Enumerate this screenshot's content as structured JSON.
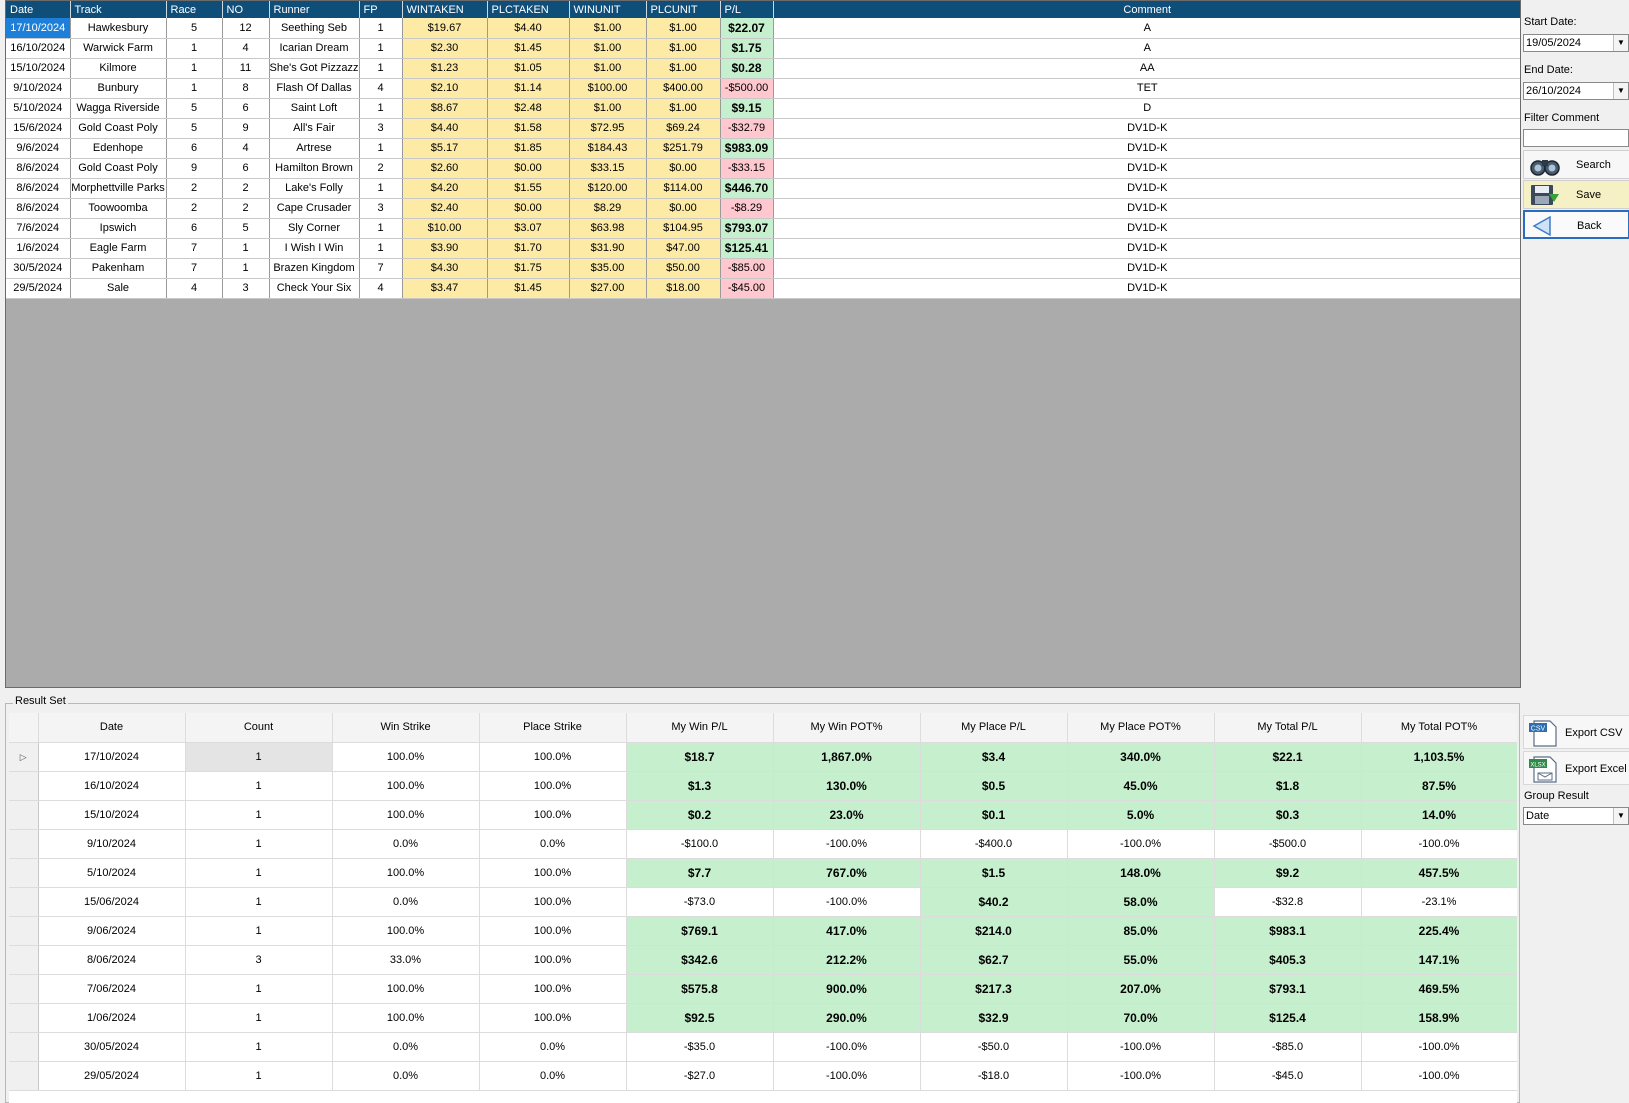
{
  "top_grid": {
    "columns": [
      "Date",
      "Track",
      "Race",
      "NO",
      "Runner",
      "FP",
      "WINTAKEN",
      "PLCTAKEN",
      "WINUNIT",
      "PLCUNIT",
      "P/L",
      "Comment"
    ],
    "rows": [
      {
        "date": "17/10/2024",
        "track": "Hawkesbury",
        "race": "5",
        "no": "12",
        "runner": "Seething Seb",
        "fp": "1",
        "wintaken": "$19.67",
        "plctaken": "$4.40",
        "winunit": "$1.00",
        "plcunit": "$1.00",
        "pl": "$22.07",
        "pl_sign": "pos",
        "comment": "A"
      },
      {
        "date": "16/10/2024",
        "track": "Warwick Farm",
        "race": "1",
        "no": "4",
        "runner": "Icarian Dream",
        "fp": "1",
        "wintaken": "$2.30",
        "plctaken": "$1.45",
        "winunit": "$1.00",
        "plcunit": "$1.00",
        "pl": "$1.75",
        "pl_sign": "pos",
        "comment": "A"
      },
      {
        "date": "15/10/2024",
        "track": "Kilmore",
        "race": "1",
        "no": "11",
        "runner": "She's Got Pizzazz",
        "fp": "1",
        "wintaken": "$1.23",
        "plctaken": "$1.05",
        "winunit": "$1.00",
        "plcunit": "$1.00",
        "pl": "$0.28",
        "pl_sign": "pos",
        "comment": "AA"
      },
      {
        "date": "9/10/2024",
        "track": "Bunbury",
        "race": "1",
        "no": "8",
        "runner": "Flash Of Dallas",
        "fp": "4",
        "wintaken": "$2.10",
        "plctaken": "$1.14",
        "winunit": "$100.00",
        "plcunit": "$400.00",
        "pl": "-$500.00",
        "pl_sign": "neg",
        "comment": "TET"
      },
      {
        "date": "5/10/2024",
        "track": "Wagga Riverside",
        "race": "5",
        "no": "6",
        "runner": "Saint Loft",
        "fp": "1",
        "wintaken": "$8.67",
        "plctaken": "$2.48",
        "winunit": "$1.00",
        "plcunit": "$1.00",
        "pl": "$9.15",
        "pl_sign": "pos",
        "comment": "D"
      },
      {
        "date": "15/6/2024",
        "track": "Gold Coast Poly",
        "race": "5",
        "no": "9",
        "runner": "All's Fair",
        "fp": "3",
        "wintaken": "$4.40",
        "plctaken": "$1.58",
        "winunit": "$72.95",
        "plcunit": "$69.24",
        "pl": "-$32.79",
        "pl_sign": "neg",
        "comment": "DV1D-K"
      },
      {
        "date": "9/6/2024",
        "track": "Edenhope",
        "race": "6",
        "no": "4",
        "runner": "Artrese",
        "fp": "1",
        "wintaken": "$5.17",
        "plctaken": "$1.85",
        "winunit": "$184.43",
        "plcunit": "$251.79",
        "pl": "$983.09",
        "pl_sign": "pos",
        "comment": "DV1D-K"
      },
      {
        "date": "8/6/2024",
        "track": "Gold Coast Poly",
        "race": "9",
        "no": "6",
        "runner": "Hamilton Brown",
        "fp": "2",
        "wintaken": "$2.60",
        "plctaken": "$0.00",
        "winunit": "$33.15",
        "plcunit": "$0.00",
        "pl": "-$33.15",
        "pl_sign": "neg",
        "comment": "DV1D-K"
      },
      {
        "date": "8/6/2024",
        "track": "Morphettville Parks",
        "race": "2",
        "no": "2",
        "runner": "Lake's Folly",
        "fp": "1",
        "wintaken": "$4.20",
        "plctaken": "$1.55",
        "winunit": "$120.00",
        "plcunit": "$114.00",
        "pl": "$446.70",
        "pl_sign": "pos",
        "comment": "DV1D-K"
      },
      {
        "date": "8/6/2024",
        "track": "Toowoomba",
        "race": "2",
        "no": "2",
        "runner": "Cape Crusader",
        "fp": "3",
        "wintaken": "$2.40",
        "plctaken": "$0.00",
        "winunit": "$8.29",
        "plcunit": "$0.00",
        "pl": "-$8.29",
        "pl_sign": "neg",
        "comment": "DV1D-K"
      },
      {
        "date": "7/6/2024",
        "track": "Ipswich",
        "race": "6",
        "no": "5",
        "runner": "Sly Corner",
        "fp": "1",
        "wintaken": "$10.00",
        "plctaken": "$3.07",
        "winunit": "$63.98",
        "plcunit": "$104.95",
        "pl": "$793.07",
        "pl_sign": "pos",
        "comment": "DV1D-K"
      },
      {
        "date": "1/6/2024",
        "track": "Eagle Farm",
        "race": "7",
        "no": "1",
        "runner": "I Wish I Win",
        "fp": "1",
        "wintaken": "$3.90",
        "plctaken": "$1.70",
        "winunit": "$31.90",
        "plcunit": "$47.00",
        "pl": "$125.41",
        "pl_sign": "pos",
        "comment": "DV1D-K"
      },
      {
        "date": "30/5/2024",
        "track": "Pakenham",
        "race": "7",
        "no": "1",
        "runner": "Brazen Kingdom",
        "fp": "7",
        "wintaken": "$4.30",
        "plctaken": "$1.75",
        "winunit": "$35.00",
        "plcunit": "$50.00",
        "pl": "-$85.00",
        "pl_sign": "neg",
        "comment": "DV1D-K"
      },
      {
        "date": "29/5/2024",
        "track": "Sale",
        "race": "4",
        "no": "3",
        "runner": "Check Your Six",
        "fp": "4",
        "wintaken": "$3.47",
        "plctaken": "$1.45",
        "winunit": "$27.00",
        "plcunit": "$18.00",
        "pl": "-$45.00",
        "pl_sign": "neg",
        "comment": "DV1D-K"
      }
    ]
  },
  "side_panel": {
    "start_date_label": "Start Date:",
    "start_date_value": "19/05/2024",
    "end_date_label": "End Date:",
    "end_date_value": "26/10/2024",
    "filter_comment_label": "Filter Comment",
    "filter_comment_value": "",
    "search_label": "Search",
    "save_label": "Save",
    "back_label": "Back",
    "search_icon": "binoculars-icon",
    "save_icon": "floppy-disk-icon",
    "back_icon": "left-arrow-icon"
  },
  "result_set": {
    "legend": "Result Set",
    "columns": [
      "Date",
      "Count",
      "Win Strike",
      "Place Strike",
      "My Win P/L",
      "My Win POT%",
      "My Place P/L",
      "My Place POT%",
      "My Total P/L",
      "My Total POT%"
    ],
    "rows": [
      {
        "date": "17/10/2024",
        "count": "1",
        "win_strike": "100.0%",
        "place_strike": "100.0%",
        "win_pl": "$18.7",
        "win_pot": "1,867.0%",
        "place_pl": "$3.4",
        "place_pot": "340.0%",
        "total_pl": "$22.1",
        "total_pot": "1,103.5%",
        "win_pos": true,
        "place_pos": true,
        "total_pos": true
      },
      {
        "date": "16/10/2024",
        "count": "1",
        "win_strike": "100.0%",
        "place_strike": "100.0%",
        "win_pl": "$1.3",
        "win_pot": "130.0%",
        "place_pl": "$0.5",
        "place_pot": "45.0%",
        "total_pl": "$1.8",
        "total_pot": "87.5%",
        "win_pos": true,
        "place_pos": true,
        "total_pos": true
      },
      {
        "date": "15/10/2024",
        "count": "1",
        "win_strike": "100.0%",
        "place_strike": "100.0%",
        "win_pl": "$0.2",
        "win_pot": "23.0%",
        "place_pl": "$0.1",
        "place_pot": "5.0%",
        "total_pl": "$0.3",
        "total_pot": "14.0%",
        "win_pos": true,
        "place_pos": true,
        "total_pos": true
      },
      {
        "date": "9/10/2024",
        "count": "1",
        "win_strike": "0.0%",
        "place_strike": "0.0%",
        "win_pl": "-$100.0",
        "win_pot": "-100.0%",
        "place_pl": "-$400.0",
        "place_pot": "-100.0%",
        "total_pl": "-$500.0",
        "total_pot": "-100.0%",
        "win_pos": false,
        "place_pos": false,
        "total_pos": false
      },
      {
        "date": "5/10/2024",
        "count": "1",
        "win_strike": "100.0%",
        "place_strike": "100.0%",
        "win_pl": "$7.7",
        "win_pot": "767.0%",
        "place_pl": "$1.5",
        "place_pot": "148.0%",
        "total_pl": "$9.2",
        "total_pot": "457.5%",
        "win_pos": true,
        "place_pos": true,
        "total_pos": true
      },
      {
        "date": "15/06/2024",
        "count": "1",
        "win_strike": "0.0%",
        "place_strike": "100.0%",
        "win_pl": "-$73.0",
        "win_pot": "-100.0%",
        "place_pl": "$40.2",
        "place_pot": "58.0%",
        "total_pl": "-$32.8",
        "total_pot": "-23.1%",
        "win_pos": false,
        "place_pos": true,
        "total_pos": false
      },
      {
        "date": "9/06/2024",
        "count": "1",
        "win_strike": "100.0%",
        "place_strike": "100.0%",
        "win_pl": "$769.1",
        "win_pot": "417.0%",
        "place_pl": "$214.0",
        "place_pot": "85.0%",
        "total_pl": "$983.1",
        "total_pot": "225.4%",
        "win_pos": true,
        "place_pos": true,
        "total_pos": true
      },
      {
        "date": "8/06/2024",
        "count": "3",
        "win_strike": "33.0%",
        "place_strike": "100.0%",
        "win_pl": "$342.6",
        "win_pot": "212.2%",
        "place_pl": "$62.7",
        "place_pot": "55.0%",
        "total_pl": "$405.3",
        "total_pot": "147.1%",
        "win_pos": true,
        "place_pos": true,
        "total_pos": true
      },
      {
        "date": "7/06/2024",
        "count": "1",
        "win_strike": "100.0%",
        "place_strike": "100.0%",
        "win_pl": "$575.8",
        "win_pot": "900.0%",
        "place_pl": "$217.3",
        "place_pot": "207.0%",
        "total_pl": "$793.1",
        "total_pot": "469.5%",
        "win_pos": true,
        "place_pos": true,
        "total_pos": true
      },
      {
        "date": "1/06/2024",
        "count": "1",
        "win_strike": "100.0%",
        "place_strike": "100.0%",
        "win_pl": "$92.5",
        "win_pot": "290.0%",
        "place_pl": "$32.9",
        "place_pot": "70.0%",
        "total_pl": "$125.4",
        "total_pot": "158.9%",
        "win_pos": true,
        "place_pos": true,
        "total_pos": true
      },
      {
        "date": "30/05/2024",
        "count": "1",
        "win_strike": "0.0%",
        "place_strike": "0.0%",
        "win_pl": "-$35.0",
        "win_pot": "-100.0%",
        "place_pl": "-$50.0",
        "place_pot": "-100.0%",
        "total_pl": "-$85.0",
        "total_pot": "-100.0%",
        "win_pos": false,
        "place_pos": false,
        "total_pos": false
      },
      {
        "date": "29/05/2024",
        "count": "1",
        "win_strike": "0.0%",
        "place_strike": "0.0%",
        "win_pl": "-$27.0",
        "win_pot": "-100.0%",
        "place_pl": "-$18.0",
        "place_pot": "-100.0%",
        "total_pl": "-$45.0",
        "total_pot": "-100.0%",
        "win_pos": false,
        "place_pos": false,
        "total_pos": false
      }
    ]
  },
  "export_panel": {
    "export_csv_label": "Export CSV",
    "export_excel_label": "Export Excel",
    "csv_icon_text": "CSV",
    "excel_icon_text": "XLSX",
    "group_result_label": "Group Result",
    "group_result_value": "Date"
  },
  "colors": {
    "header_bg": "#104e7a",
    "positive_bg": "#c6efce",
    "negative_bg": "#ffc7ce",
    "taken_bg": "#fdeaa4",
    "selected_bg": "#1e7fd8"
  }
}
